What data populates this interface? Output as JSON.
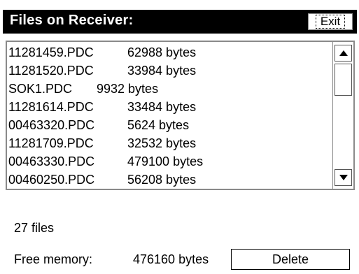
{
  "window": {
    "title": "Files on Receiver:",
    "exit_label": "Exit"
  },
  "file_list": {
    "items": [
      {
        "name": "11281459.PDC",
        "size": "62988 bytes"
      },
      {
        "name": "11281520.PDC",
        "size": "33984 bytes"
      },
      {
        "name": "SOK1.PDC",
        "size": "9932 bytes"
      },
      {
        "name": "11281614.PDC",
        "size": "33484 bytes"
      },
      {
        "name": "00463320.PDC",
        "size": "5624 bytes"
      },
      {
        "name": "11281709.PDC",
        "size": "32532 bytes"
      },
      {
        "name": "00463330.PDC",
        "size": "479100 bytes"
      },
      {
        "name": "00460250.PDC",
        "size": "56208 bytes"
      }
    ]
  },
  "scrollbar": {
    "up_icon": "arrow-up-icon",
    "down_icon": "arrow-down-icon"
  },
  "status": {
    "file_count": "27 files",
    "free_memory_label": "Free memory:",
    "free_memory_value": "476160 bytes"
  },
  "actions": {
    "delete_label": "Delete"
  }
}
